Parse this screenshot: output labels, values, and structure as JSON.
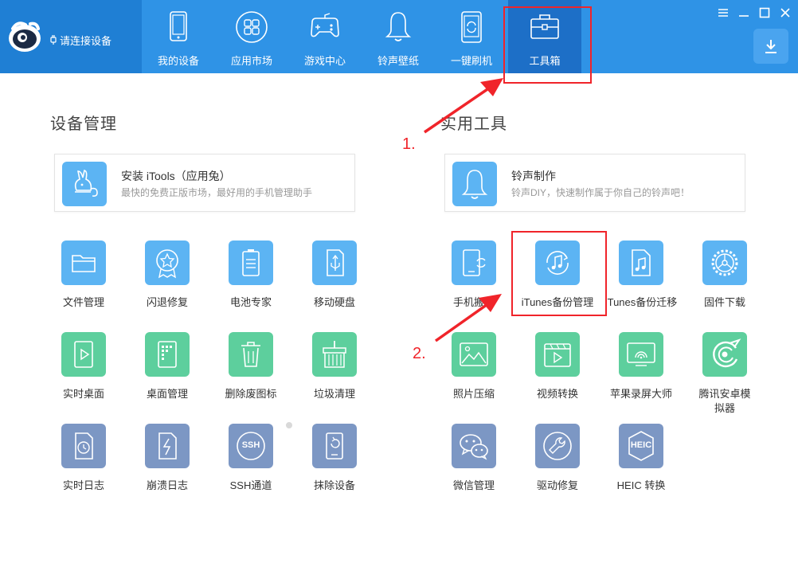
{
  "header": {
    "device_status": "请连接设备",
    "tabs": [
      {
        "label": "我的设备",
        "icon": "tablet-icon"
      },
      {
        "label": "应用市场",
        "icon": "apps-grid-icon"
      },
      {
        "label": "游戏中心",
        "icon": "gamepad-icon"
      },
      {
        "label": "铃声壁纸",
        "icon": "bell-icon"
      },
      {
        "label": "一键刷机",
        "icon": "phone-refresh-icon"
      },
      {
        "label": "工具箱",
        "icon": "toolbox-icon"
      }
    ],
    "active_tab": "工具箱",
    "accent_color": "#2f93e6"
  },
  "device_management": {
    "title": "设备管理",
    "feature": {
      "title": "安装 iTools（应用兔）",
      "desc": "最快的免费正版市场，最好用的手机管理助手",
      "icon": "rabbit-icon"
    },
    "tools": [
      {
        "label": "文件管理",
        "icon": "folder-icon",
        "color": "#5cb4f3"
      },
      {
        "label": "闪退修复",
        "icon": "medal-star-icon",
        "color": "#5cb4f3"
      },
      {
        "label": "电池专家",
        "icon": "battery-icon",
        "color": "#5cb4f3"
      },
      {
        "label": "移动硬盘",
        "icon": "usb-drive-icon",
        "color": "#5cb4f3"
      },
      {
        "label": "实时桌面",
        "icon": "play-screen-icon",
        "color": "#5dcf9d"
      },
      {
        "label": "桌面管理",
        "icon": "desktop-grid-icon",
        "color": "#5dcf9d"
      },
      {
        "label": "删除废图标",
        "icon": "trash-icon",
        "color": "#5dcf9d"
      },
      {
        "label": "垃圾清理",
        "icon": "broom-icon",
        "color": "#5dcf9d"
      },
      {
        "label": "实时日志",
        "icon": "clock-doc-icon",
        "color": "#7c97c4"
      },
      {
        "label": "崩溃日志",
        "icon": "lightning-doc-icon",
        "color": "#7c97c4"
      },
      {
        "label": "SSH通道",
        "icon": "ssh-icon",
        "color": "#7c97c4",
        "text": "SSH"
      },
      {
        "label": "抹除设备",
        "icon": "erase-device-icon",
        "color": "#7c97c4"
      }
    ]
  },
  "utilities": {
    "title": "实用工具",
    "feature": {
      "title": "铃声制作",
      "desc": "铃声DIY，快速制作属于你自己的铃声吧！",
      "icon": "bell-icon"
    },
    "tools": [
      {
        "label": "手机搬家",
        "icon": "phone-transfer-icon",
        "color": "#5cb4f3"
      },
      {
        "label": "iTunes备份管理",
        "icon": "music-backup-icon",
        "color": "#5cb4f3"
      },
      {
        "label": "iTunes备份迁移",
        "icon": "music-folder-icon",
        "color": "#5cb4f3"
      },
      {
        "label": "固件下载",
        "icon": "gear-icon",
        "color": "#5cb4f3"
      },
      {
        "label": "照片压缩",
        "icon": "photo-icon",
        "color": "#5dcf9d"
      },
      {
        "label": "视频转换",
        "icon": "video-icon",
        "color": "#5dcf9d"
      },
      {
        "label": "苹果录屏大师",
        "icon": "screen-mirror-icon",
        "color": "#5dcf9d"
      },
      {
        "label": "腾讯安卓模拟器",
        "icon": "android-emulator-icon",
        "color": "#5dcf9d"
      },
      {
        "label": "微信管理",
        "icon": "wechat-icon",
        "color": "#7c97c4"
      },
      {
        "label": "驱动修复",
        "icon": "wrench-icon",
        "color": "#7c97c4"
      },
      {
        "label": "HEIC 转换",
        "icon": "heic-icon",
        "color": "#7c97c4",
        "text": "HEIC"
      }
    ]
  },
  "annotations": {
    "step1": "1.",
    "step2": "2.",
    "color": "#f0242a"
  }
}
